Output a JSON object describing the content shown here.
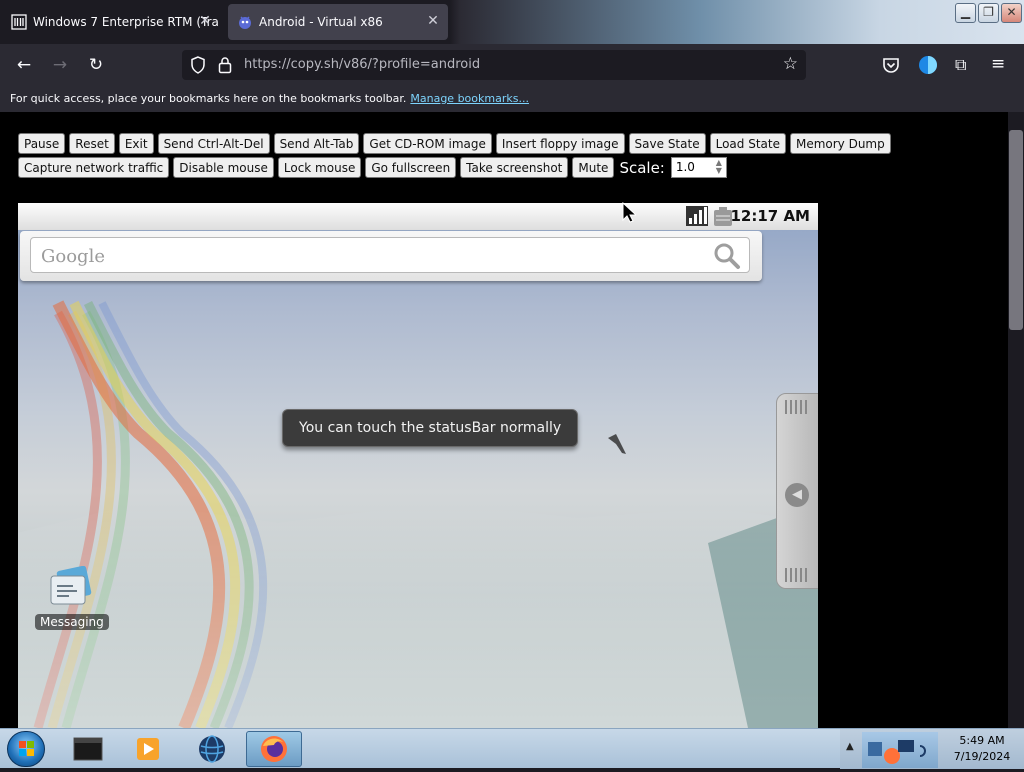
{
  "browser": {
    "tabs": [
      {
        "title": "Windows 7 Enterprise RTM (Tra",
        "active": false
      },
      {
        "title": "Android - Virtual x86",
        "active": true
      }
    ],
    "url": "https://copy.sh/v86/?profile=android",
    "bookmarks_hint": "For quick access, place your bookmarks here on the bookmarks toolbar.",
    "bookmarks_link": "Manage bookmarks..."
  },
  "controls": {
    "row1": [
      "Pause",
      "Reset",
      "Exit",
      "Send Ctrl-Alt-Del",
      "Send Alt-Tab",
      "Get CD-ROM image",
      "Insert floppy image",
      "Save State",
      "Load State",
      "Memory Dump"
    ],
    "row2": [
      "Capture network traffic",
      "Disable mouse",
      "Lock mouse",
      "Go fullscreen",
      "Take screenshot",
      "Mute"
    ],
    "scale_label": "Scale:",
    "scale_value": "1.0"
  },
  "android": {
    "status_time": "12:17 AM",
    "search_placeholder": "Google",
    "toast": "You can touch the statusBar normally",
    "desktop_icons": [
      {
        "label": "Messaging",
        "icon": "messaging-icon"
      }
    ]
  },
  "taskbar": {
    "time": "5:49 AM",
    "date": "7/19/2024",
    "apps": [
      "terminal-icon",
      "media-player-icon",
      "globe-icon",
      "firefox-icon"
    ]
  },
  "colors": {
    "browser_chrome": "#2b2a33",
    "page_bg": "#000000",
    "link": "#7dd3fc",
    "taskbar": "#b8cde0"
  }
}
